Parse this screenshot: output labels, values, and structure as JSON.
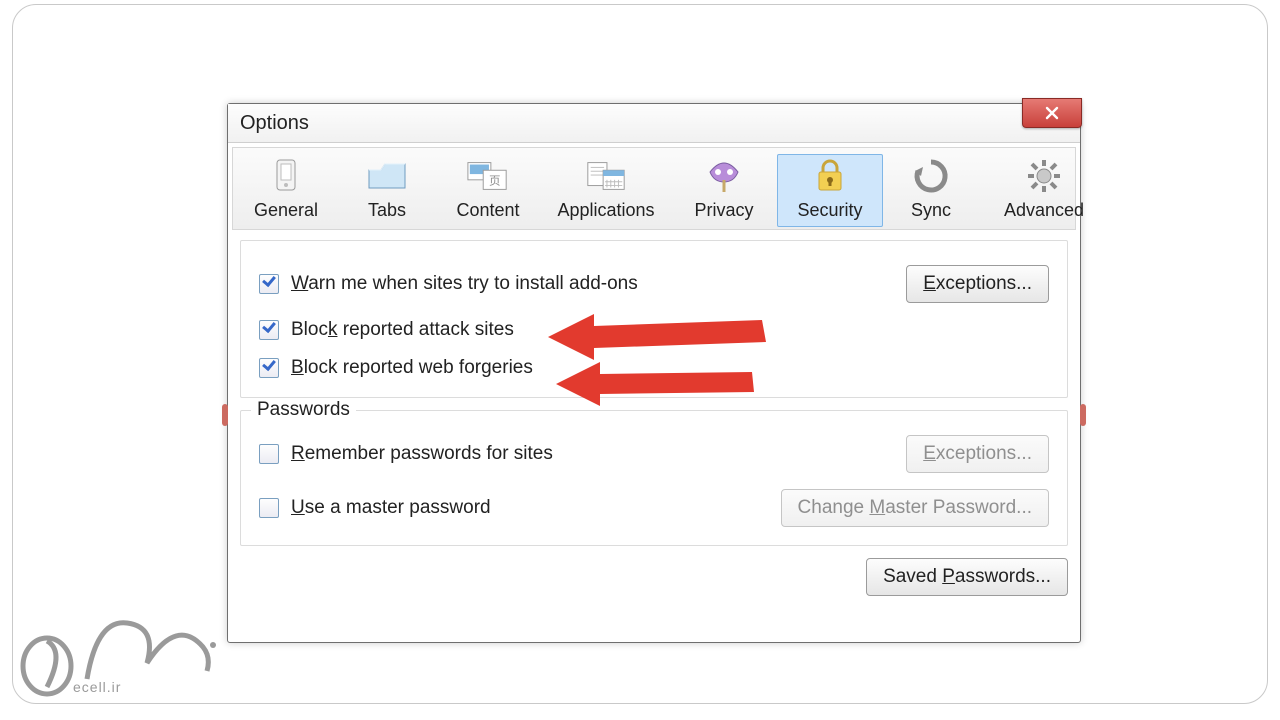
{
  "window": {
    "title": "Options"
  },
  "tabs": {
    "general": {
      "label": "General"
    },
    "tabs": {
      "label": "Tabs"
    },
    "content": {
      "label": "Content"
    },
    "applications": {
      "label": "Applications"
    },
    "privacy": {
      "label": "Privacy"
    },
    "security": {
      "label": "Security"
    },
    "sync": {
      "label": "Sync"
    },
    "advanced": {
      "label": "Advanced"
    }
  },
  "security": {
    "warn_addons": {
      "prefix": "W",
      "text": "arn me when sites try to install add-ons"
    },
    "block_attack": {
      "prefix": "Bloc",
      "u": "k",
      "text": " reported attack sites"
    },
    "block_forgery": {
      "prefix": "B",
      "text": "lock reported web forgeries"
    },
    "exceptions": {
      "prefix": "E",
      "text": "xceptions..."
    }
  },
  "passwords": {
    "group_label": "Passwords",
    "remember": {
      "prefix": "R",
      "text": "emember passwords for sites"
    },
    "master": {
      "prefix": "U",
      "text": "se a master password"
    },
    "exceptions": {
      "prefix": "E",
      "text": "xceptions..."
    },
    "change_master": {
      "pre": "Change ",
      "u": "M",
      "post": "aster Password..."
    },
    "saved": {
      "pre": "Saved ",
      "u": "P",
      "post": "asswords..."
    }
  },
  "watermark": {
    "text": "ecell.ir"
  }
}
